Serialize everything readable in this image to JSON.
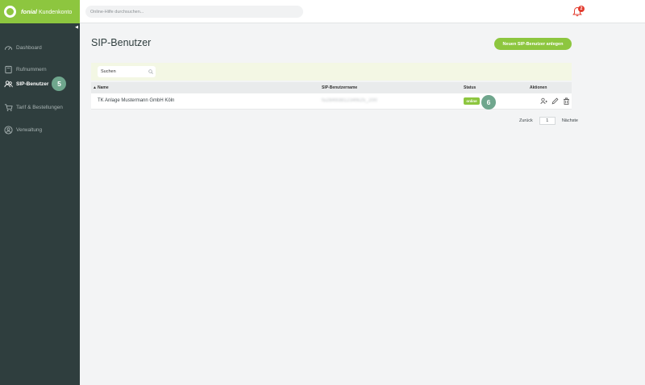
{
  "brand": {
    "name": "fonial",
    "suffix": "Kundenkonto"
  },
  "header": {
    "search_placeholder": "Online-Hilfe durchsuchen...",
    "notification_count": "2"
  },
  "sidebar": {
    "items": [
      {
        "label": "Dashboard",
        "icon": "dashboard-icon"
      },
      {
        "label": "Rufnummern",
        "icon": "phone-book-icon"
      },
      {
        "label": "SIP-Benutzer",
        "icon": "users-icon",
        "active": true,
        "badge": "5"
      },
      {
        "label": "Tarif & Bestellungen",
        "icon": "cart-icon"
      },
      {
        "label": "Verwaltung",
        "icon": "user-circle-icon"
      }
    ]
  },
  "main": {
    "title": "SIP-Benutzer",
    "add_button": "Neuen SIP-Benutzer anlegen",
    "filter_placeholder": "Suchen",
    "table": {
      "columns": {
        "name": "Name",
        "username": "SIP-Benutzername",
        "status": "Status",
        "actions": "Aktionen"
      },
      "rows": [
        {
          "name": "TK Anlage Mustermann GmbH Köln",
          "username": "fu2849381234fk25_200",
          "status": "online",
          "badge": "6"
        }
      ]
    },
    "pagination": {
      "prev": "Zurück",
      "page": "1",
      "next": "Nächste"
    }
  },
  "colors": {
    "brand": "#8dc63f",
    "sidebar": "#2f3e3e",
    "badge": "#6fa68d",
    "alert": "#e23b2e"
  }
}
